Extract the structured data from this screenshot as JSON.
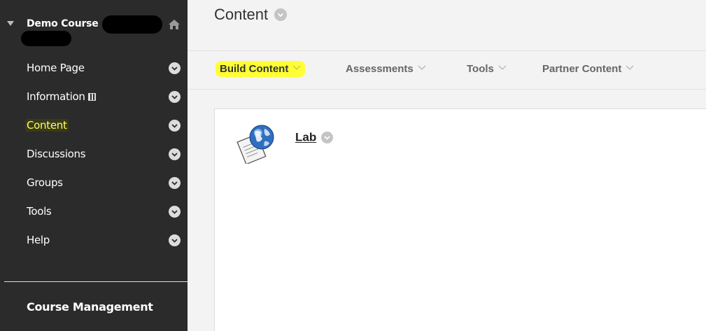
{
  "sidebar": {
    "course_title": "Demo Course",
    "items": [
      {
        "label": "Home Page",
        "active": false
      },
      {
        "label": "Information",
        "active": false
      },
      {
        "label": "Content",
        "active": true
      },
      {
        "label": "Discussions",
        "active": false
      },
      {
        "label": "Groups",
        "active": false
      },
      {
        "label": "Tools",
        "active": false
      },
      {
        "label": "Help",
        "active": false
      }
    ],
    "course_management": "Course Management",
    "icons": {
      "collapse": "triangle-down-icon",
      "home": "home-icon",
      "item_menu": "chevron-down-circle-icon",
      "information_badge": "calendar-icon"
    }
  },
  "main": {
    "page_title": "Content",
    "action_bar": [
      {
        "label": "Build Content",
        "highlighted": true
      },
      {
        "label": "Assessments",
        "highlighted": false
      },
      {
        "label": "Tools",
        "highlighted": false
      },
      {
        "label": "Partner Content",
        "highlighted": false
      }
    ],
    "content_items": [
      {
        "title": "Lab",
        "icon": "globe-document-icon"
      }
    ]
  },
  "colors": {
    "sidebar_bg": "#2b2b2b",
    "main_bg": "#f3f3f3",
    "highlight": "#ffff33",
    "active_text": "#ffff66"
  }
}
